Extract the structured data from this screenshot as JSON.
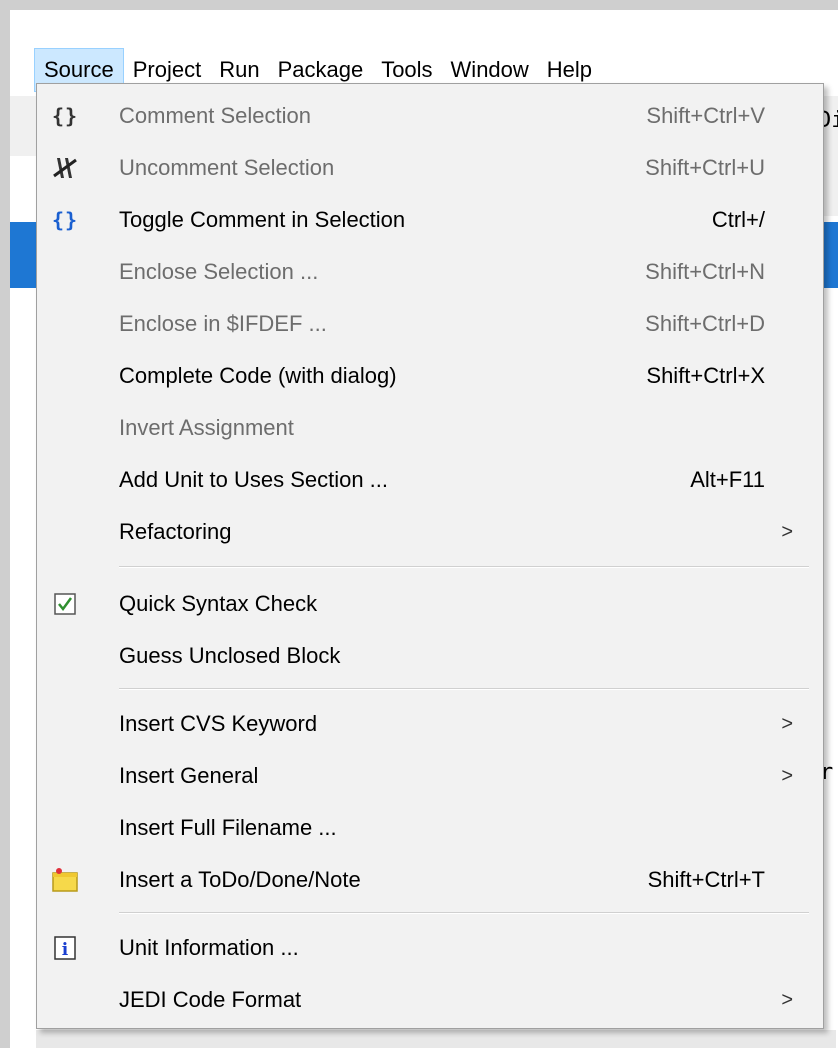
{
  "menubar": {
    "items": [
      "Source",
      "Project",
      "Run",
      "Package",
      "Tools",
      "Window",
      "Help"
    ]
  },
  "background": {
    "right_text_1": "Di",
    "right_text_2": "r"
  },
  "menu": {
    "items": [
      {
        "label": "Comment Selection",
        "shortcut": "Shift+Ctrl+V",
        "icon": "comment-braces-icon",
        "enabled": false
      },
      {
        "label": "Uncomment Selection",
        "shortcut": "Shift+Ctrl+U",
        "icon": "uncomment-icon",
        "enabled": false
      },
      {
        "label": "Toggle Comment in Selection",
        "shortcut": "Ctrl+/",
        "icon": "toggle-comment-braces-icon",
        "enabled": true
      },
      {
        "label": "Enclose Selection ...",
        "shortcut": "Shift+Ctrl+N",
        "enabled": false
      },
      {
        "label": "Enclose in $IFDEF ...",
        "shortcut": "Shift+Ctrl+D",
        "enabled": false
      },
      {
        "label": "Complete Code (with dialog)",
        "shortcut": "Shift+Ctrl+X",
        "enabled": true
      },
      {
        "label": "Invert Assignment",
        "shortcut": "",
        "enabled": false
      },
      {
        "label": "Add Unit to Uses Section ...",
        "shortcut": "Alt+F11",
        "enabled": true
      },
      {
        "label": "Refactoring",
        "shortcut": "",
        "submenu": true,
        "enabled": true
      },
      {
        "label": "Quick Syntax Check",
        "shortcut": "",
        "icon": "syntax-check-icon",
        "enabled": true
      },
      {
        "label": "Guess Unclosed Block",
        "shortcut": "",
        "enabled": true
      },
      {
        "label": "Insert CVS Keyword",
        "shortcut": "",
        "submenu": true,
        "enabled": true
      },
      {
        "label": "Insert General",
        "shortcut": "",
        "submenu": true,
        "enabled": true
      },
      {
        "label": "Insert Full Filename ...",
        "shortcut": "",
        "enabled": true
      },
      {
        "label": "Insert a ToDo/Done/Note",
        "shortcut": "Shift+Ctrl+T",
        "icon": "todo-note-icon",
        "enabled": true
      },
      {
        "label": "Unit Information ...",
        "shortcut": "",
        "icon": "info-icon",
        "enabled": true
      },
      {
        "label": "JEDI Code Format",
        "shortcut": "",
        "submenu": true,
        "enabled": true
      }
    ],
    "submenu_arrow": ">"
  }
}
